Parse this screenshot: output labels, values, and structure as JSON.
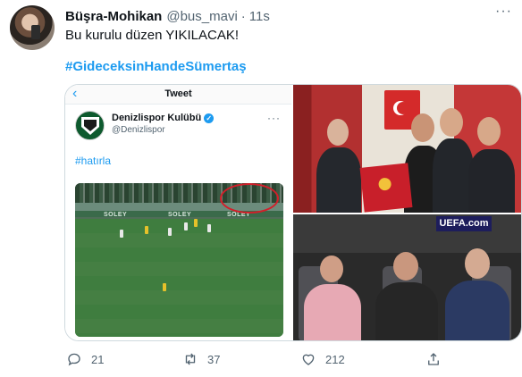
{
  "tweet": {
    "display_name": "Büşra-Mohikan",
    "handle": "@bus_mavi",
    "separator": "·",
    "time": "11s",
    "text": "Bu kurulu düzen YIKILACAK!",
    "hashtag": "#GideceksinHandeSümertaş"
  },
  "embedded_screenshot": {
    "back_icon": "chevron-left-icon",
    "title": "Tweet",
    "account_name": "Denizlispor Kulübü",
    "account_handle": "@Denizlispor",
    "verified_mark": "✓",
    "more": "···",
    "hashtag": "#hatırla",
    "ad_text": "SOLEY",
    "ad_text_2": "SOLEY",
    "ad_text_3": "SOLEY"
  },
  "photos": {
    "uefa_board": "UEFA.com"
  },
  "actions": {
    "reply_count": "21",
    "retweet_count": "37",
    "like_count": "212"
  },
  "colors": {
    "accent": "#1d9bf0",
    "secondary_text": "#536471",
    "highlight_circle": "#d21f2a"
  }
}
